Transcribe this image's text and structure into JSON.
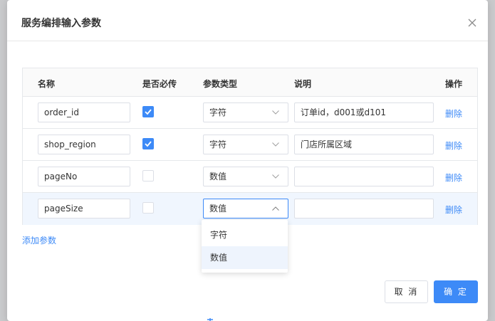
{
  "dialog": {
    "title": "服务编排输入参数",
    "close_icon": "close-icon"
  },
  "table": {
    "headers": {
      "name": "名称",
      "required": "是否必传",
      "type": "参数类型",
      "desc": "说明",
      "action": "操作"
    },
    "rows": [
      {
        "name": "order_id",
        "required": true,
        "type": "字符",
        "desc": "订单id，d001或d101",
        "action": "删除"
      },
      {
        "name": "shop_region",
        "required": true,
        "type": "字符",
        "desc": "门店所属区域",
        "action": "删除"
      },
      {
        "name": "pageNo",
        "required": false,
        "type": "数值",
        "desc": "",
        "action": "删除"
      },
      {
        "name": "pageSize",
        "required": false,
        "type": "数值",
        "desc": "",
        "action": "删除"
      }
    ]
  },
  "dropdown": {
    "options": [
      "字符",
      "数值"
    ],
    "selected": "数值"
  },
  "add_param": "添加参数",
  "footer": {
    "cancel": "取 消",
    "ok": "确 定"
  },
  "colors": {
    "primary": "#3d8af7",
    "border": "#dcdfe6",
    "header_bg": "#fafafa",
    "highlight_row": "#f0f6fe",
    "overlay": "#c9cacc"
  }
}
